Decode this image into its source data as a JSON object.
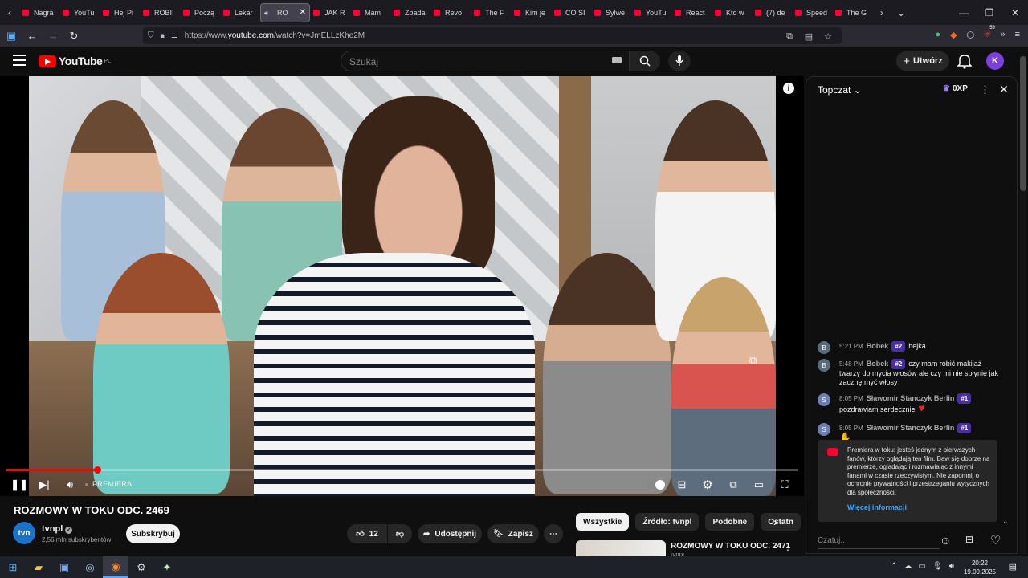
{
  "browser": {
    "tabs": [
      {
        "label": "Nagra"
      },
      {
        "label": "YouTu"
      },
      {
        "label": "Hej Pi"
      },
      {
        "label": "ROBI!"
      },
      {
        "label": "Począ"
      },
      {
        "label": "Lekar"
      },
      {
        "label": "RO",
        "active": true
      },
      {
        "label": "JAK R"
      },
      {
        "label": "Mam"
      },
      {
        "label": "Zbada"
      },
      {
        "label": "Revo"
      },
      {
        "label": "The F"
      },
      {
        "label": "Kim je"
      },
      {
        "label": "CO SI"
      },
      {
        "label": "Sylwe"
      },
      {
        "label": "YouTu"
      },
      {
        "label": "React"
      },
      {
        "label": "Kto w"
      },
      {
        "label": "(7) de"
      },
      {
        "label": "Speed"
      },
      {
        "label": "The G"
      }
    ],
    "url_prefix": "https://www.",
    "url_host": "youtube.com",
    "url_path": "/watch?v=JmELLzKhe2M",
    "extensions_badge": "59"
  },
  "youtube": {
    "logo_text": "YouTube",
    "region": "PL",
    "search_placeholder": "Szukaj",
    "create_label": "Utwórz",
    "avatar_letter": "K"
  },
  "player": {
    "status": "PREMIERA",
    "progress": 0.115
  },
  "video": {
    "title": "ROZMOWY W TOKU ODC. 2469",
    "channel_logo": "tvn",
    "channel": "tvnpl",
    "subscribers": "2,56 mln subskrybentów",
    "subscribe_label": "Subskrybuj",
    "likes": "12",
    "share_label": "Udostępnij",
    "save_label": "Zapisz"
  },
  "chips": [
    "Wszystkie",
    "Źródło: tvnpl",
    "Podobne",
    "Ostatn"
  ],
  "recommendation": {
    "title": "ROZMOWY W TOKU ODC. 2471",
    "channel": "tvnpl"
  },
  "chat": {
    "mode": "Topczat",
    "xp": "0XP",
    "messages": [
      {
        "avatar": "B",
        "time": "5:21 PM",
        "author": "Bobek",
        "badge": "#2",
        "text": "hejka"
      },
      {
        "avatar": "B",
        "time": "5:48 PM",
        "author": "Bobek",
        "badge": "#2",
        "text": "czy mam robić makijaż twarzy do mycia włosów ale czy mi nie spłynie jak zacznę myć włosy"
      },
      {
        "avatar": "S",
        "time": "8:05 PM",
        "author": "Sławomir Stanczyk Berlin",
        "badge": "#1",
        "text": "pozdrawiam serdecznie"
      },
      {
        "avatar": "S",
        "time": "8:05 PM",
        "author": "Sławomir Stanczyk Berlin",
        "badge": "#1",
        "text": ""
      }
    ],
    "notice": "Premiera w toku: jesteś jednym z pierwszych fanów, którzy oglądają ten film. Baw się dobrze na premierze, oglądając i rozmawiając z innymi fanami w czasie rzeczywistym. Nie zapomnij o ochronie prywatności i przestrzeganiu wytycznych dla społeczności.",
    "notice_link": "Więcej informacji",
    "input_placeholder": "Czatuj..."
  },
  "taskbar": {
    "time": "20:22",
    "date": "19.09.2025"
  }
}
